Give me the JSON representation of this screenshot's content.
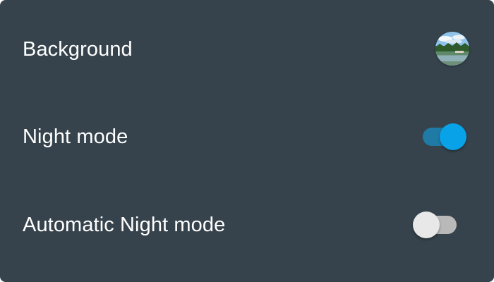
{
  "settings": {
    "background": {
      "label": "Background",
      "thumbnail_icon": "landscape-lake-photo"
    },
    "night_mode": {
      "label": "Night mode",
      "enabled": true
    },
    "automatic_night_mode": {
      "label": "Automatic Night mode",
      "enabled": false
    }
  },
  "colors": {
    "panel_background": "#36434c",
    "accent": "#08a2e9",
    "accent_track": "#1f7aa5",
    "off_knob": "#e8e8e8",
    "off_track": "#b9b9b9"
  }
}
